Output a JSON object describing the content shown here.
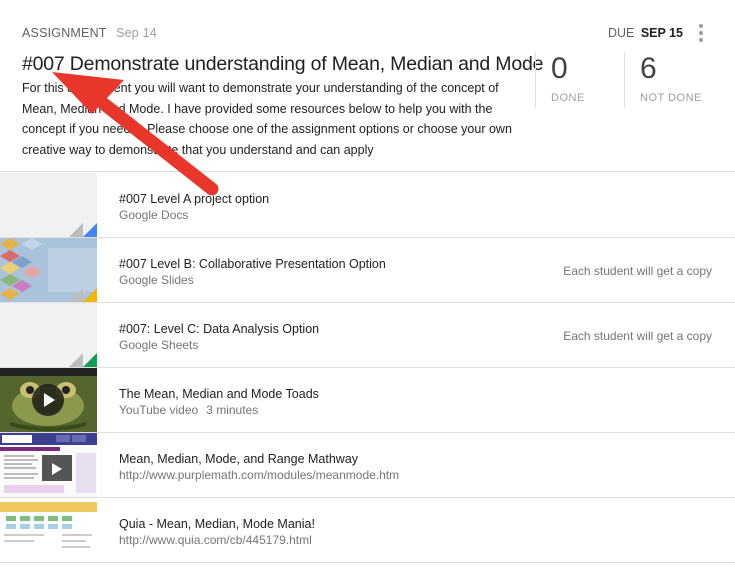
{
  "assignment": {
    "type_label": "Assignment",
    "posted_date": "Sep 14",
    "due_label": "DUE",
    "due_date": "SEP 15",
    "title": "#007 Demonstrate understanding of Mean, Median and Mode",
    "description": "For this assignment you will want to demonstrate your understanding of the concept of Mean, Median and Mode. I have provided some resources below to help you with the concept if you need it. Please choose one of the assignment options or choose your own creative way to demonstrate that you understand and can apply"
  },
  "stats": {
    "done": {
      "count": "0",
      "label": "DONE"
    },
    "not_done": {
      "count": "6",
      "label": "NOT DONE"
    }
  },
  "materials": [
    {
      "title": "#007 Level A project option",
      "subtitle": "Google Docs",
      "duration": "",
      "note": "",
      "icon": "google-docs-icon",
      "color": "#4285f4"
    },
    {
      "title": "#007 Level B: Collaborative Presentation Option",
      "subtitle": "Google Slides",
      "duration": "",
      "note": "Each student will get a copy",
      "icon": "google-slides-icon",
      "color": "#f4b400"
    },
    {
      "title": "#007: Level C: Data Analysis Option",
      "subtitle": "Google Sheets",
      "duration": "",
      "note": "Each student will get a copy",
      "icon": "google-sheets-icon",
      "color": "#0f9d58"
    },
    {
      "title": "The Mean, Median and Mode Toads",
      "subtitle": "YouTube video",
      "duration": "3 minutes",
      "note": "",
      "icon": "play-icon",
      "color": "#212121"
    },
    {
      "title": "Mean, Median, Mode, and Range Mathway",
      "subtitle": "http://www.purplemath.com/modules/meanmode.htm",
      "duration": "",
      "note": "",
      "icon": "webpage-thumbnail",
      "color": "#3f3f8f"
    },
    {
      "title": "Quia - Mean, Median, Mode Mania!",
      "subtitle": "http://www.quia.com/cb/445179.html",
      "duration": "",
      "note": "",
      "icon": "webpage-thumbnail",
      "color": "#f0c860"
    }
  ],
  "colors": {
    "annotation_arrow": "#e8372a"
  }
}
